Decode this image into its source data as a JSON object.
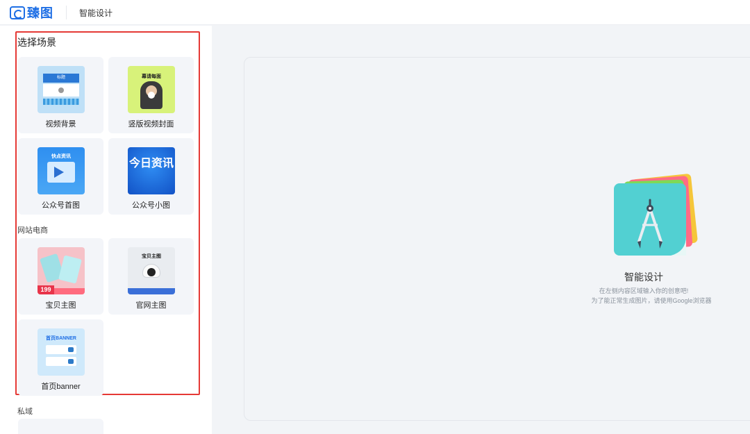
{
  "header": {
    "logo_text": "臻图",
    "page_title": "智能设计"
  },
  "sidebar": {
    "section_title": "选择场景",
    "groups": [
      {
        "name": "",
        "items": [
          {
            "label": "视频背景",
            "thumb_text": "标题"
          },
          {
            "label": "竖版视频封面",
            "thumb_text": "幕请每面"
          },
          {
            "label": "公众号首图",
            "thumb_text": "快点资讯"
          },
          {
            "label": "公众号小图",
            "thumb_text": "今日资讯"
          }
        ]
      },
      {
        "name": "网站电商",
        "items": [
          {
            "label": "宝贝主图",
            "thumb_text": "199"
          },
          {
            "label": "官网主图",
            "thumb_text": "宝贝主图"
          },
          {
            "label": "首页banner",
            "thumb_text": "首页BANNER"
          }
        ]
      },
      {
        "name": "私域",
        "items": []
      }
    ]
  },
  "main": {
    "empty_title": "智能设计",
    "empty_tip_1": "在左侧内容区域输入你的创意吧!",
    "empty_tip_2": "为了能正常生成图片，请使用Google浏览器"
  },
  "colors": {
    "brand": "#1f6fe5",
    "highlight_frame": "#e53935"
  }
}
